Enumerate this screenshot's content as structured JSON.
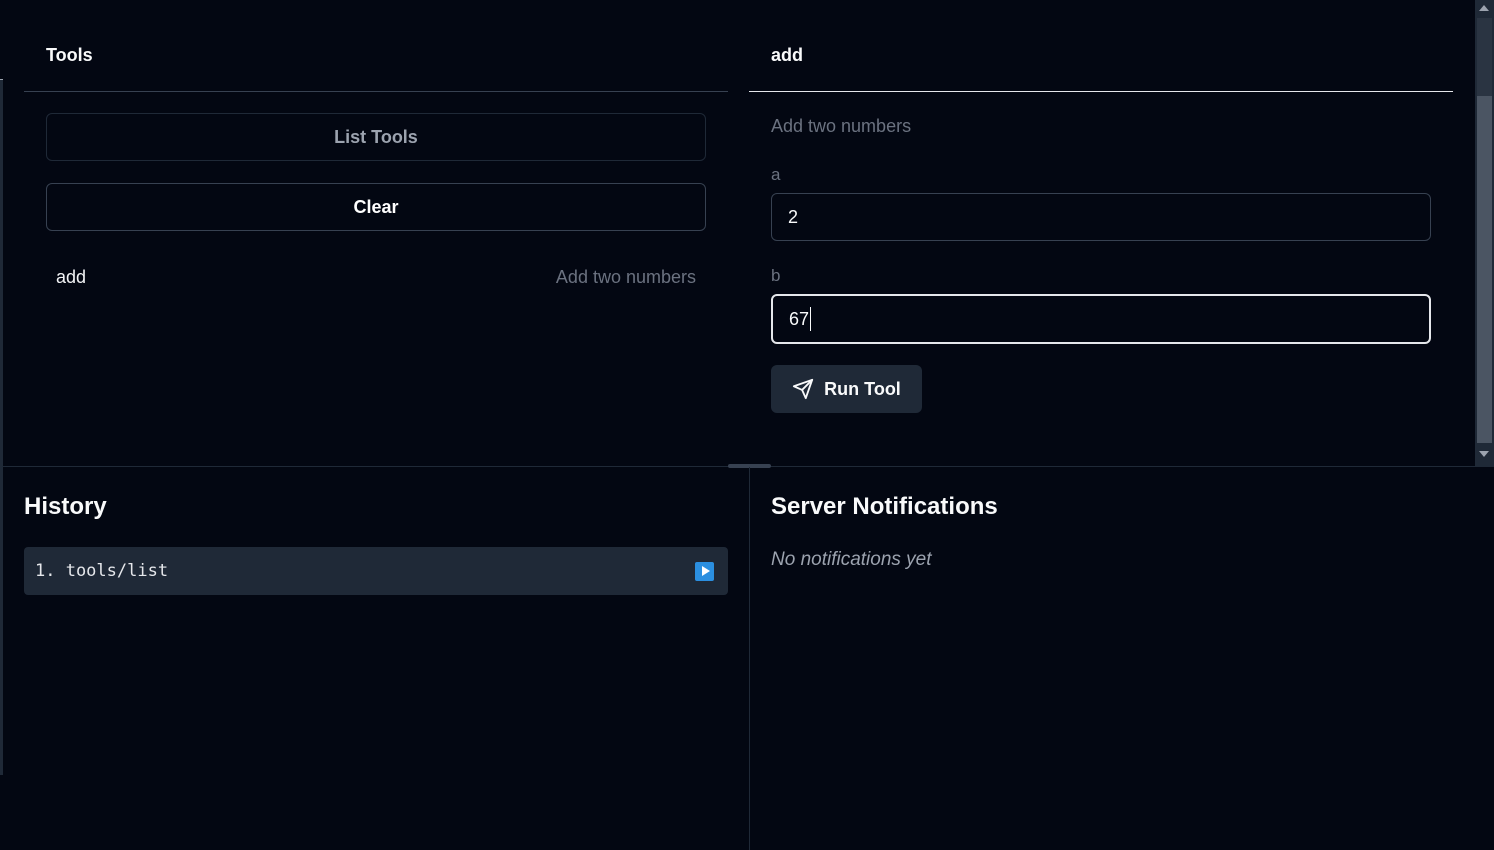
{
  "tools_panel": {
    "title": "Tools",
    "list_button": "List Tools",
    "clear_button": "Clear",
    "tools": [
      {
        "name": "add",
        "description": "Add two numbers"
      }
    ]
  },
  "tool_detail": {
    "title": "add",
    "description": "Add two numbers",
    "params": [
      {
        "label": "a",
        "value": "2"
      },
      {
        "label": "b",
        "value": "67"
      }
    ],
    "run_button": "Run Tool"
  },
  "history": {
    "title": "History",
    "items": [
      {
        "label": "1. tools/list"
      }
    ]
  },
  "notifications": {
    "title": "Server Notifications",
    "empty_text": "No notifications yet"
  },
  "colors": {
    "background": "#030712",
    "surface": "#1f2937",
    "muted_text": "#6b7280",
    "accent_play": "#2b8fe0"
  },
  "icons": {
    "run": "send-icon",
    "history_action": "play-icon"
  }
}
